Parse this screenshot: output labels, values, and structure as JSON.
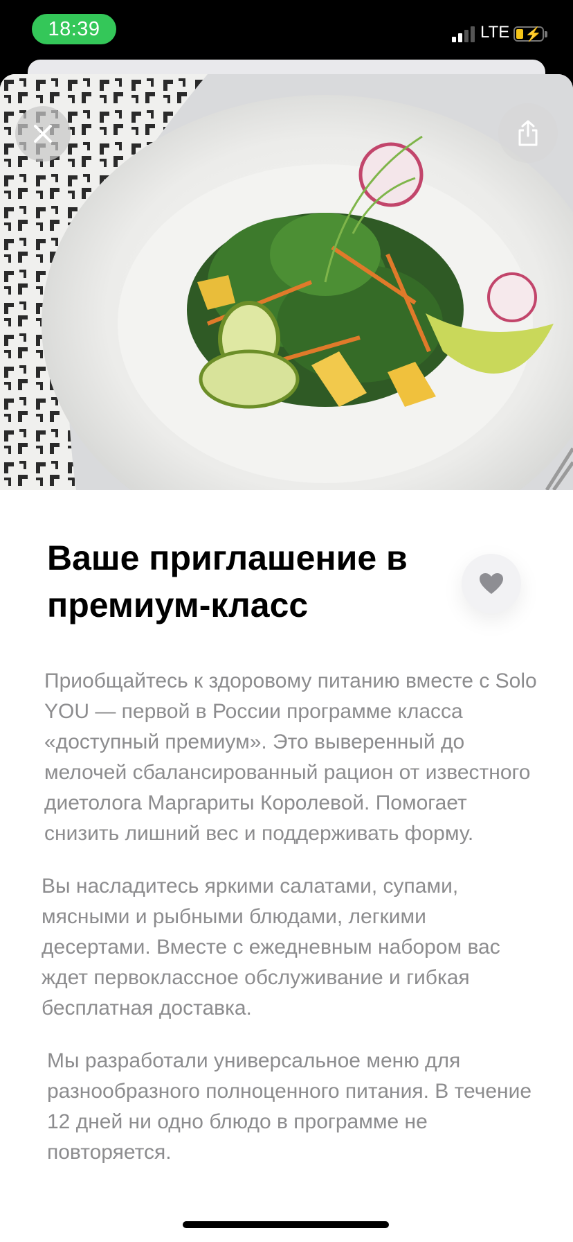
{
  "status_bar": {
    "time": "18:39",
    "network": "LTE",
    "signal_bars": 4,
    "signal_active_bars": 2,
    "battery_state": "charging",
    "battery_level": 0.25
  },
  "hero": {
    "image": "salad-plate-photo",
    "close_icon": "close-icon",
    "share_icon": "share-icon"
  },
  "article": {
    "title": "Ваше приглашение в премиум-класс",
    "favorite_icon": "heart-icon",
    "paragraphs": [
      "Приобщайтесь к здоровому питанию вместе с Solo YOU — первой в России программе класса «доступный премиум». Это выверенный до мелочей сбалансированный рацион от известного диетолога Маргариты Королевой. Помогает снизить лишний вес и поддерживать форму.",
      "Вы насладитесь яркими салатами, супами, мясными и рыбными блюдами, легкими десертами. Вместе с ежедневным набором вас ждет первоклассное обслуживание и гибкая бесплатная доставка.",
      "Мы разработали универсальное меню для разнообразного полноценного питания. В течение 12 дней ни одно блюдо в программе не повторяется."
    ]
  },
  "colors": {
    "status_time_pill": "#34c759",
    "body_text": "#8c8c8e",
    "title_text": "#000000"
  }
}
